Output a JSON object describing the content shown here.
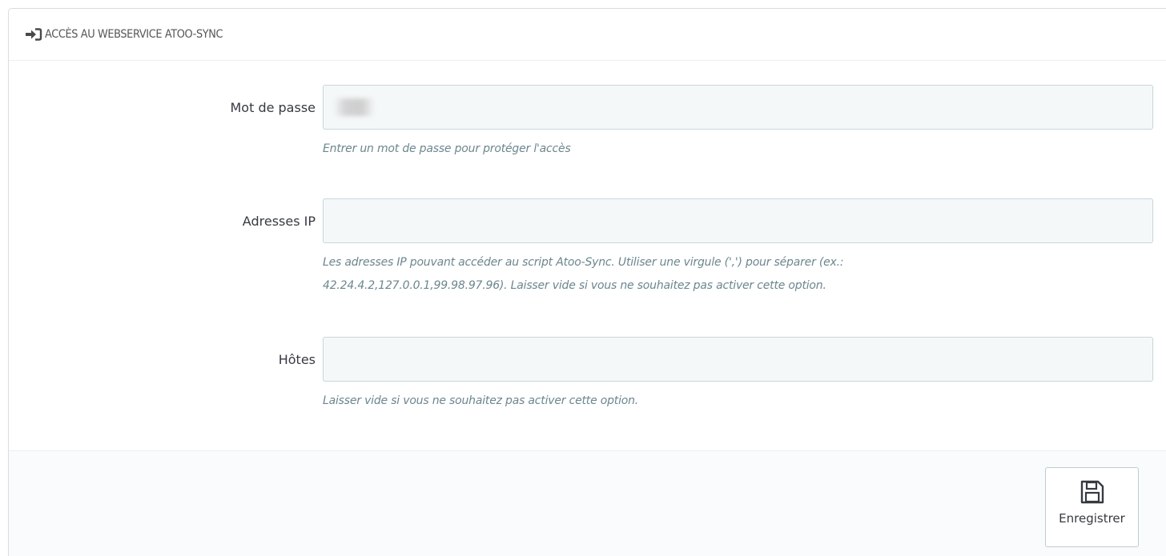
{
  "panel": {
    "title": "ACCÈS AU WEBSERVICE ATOO-SYNC",
    "title_icon": "sign-in-icon"
  },
  "fields": {
    "password": {
      "label": "Mot de passe",
      "value": "",
      "help": "Entrer un mot de passe pour protéger l'accès"
    },
    "ip": {
      "label": "Adresses IP",
      "value": "",
      "help_line1": "Les adresses IP pouvant accéder au script Atoo-Sync. Utiliser une virgule (',') pour séparer (ex.:",
      "help_line2": "42.24.4.2,127.0.0.1,99.98.97.96). Laisser vide si vous ne souhaitez pas activer cette option."
    },
    "hosts": {
      "label": "Hôtes",
      "value": "",
      "help": "Laisser vide si vous ne souhaitez pas activer cette option."
    }
  },
  "footer": {
    "save_label": "Enregistrer",
    "save_icon": "floppy-disk-icon"
  },
  "colors": {
    "input_bg": "#f5f8f9",
    "input_border": "#c7d6db",
    "help_text": "#6c868e",
    "label_text": "#363a41"
  }
}
